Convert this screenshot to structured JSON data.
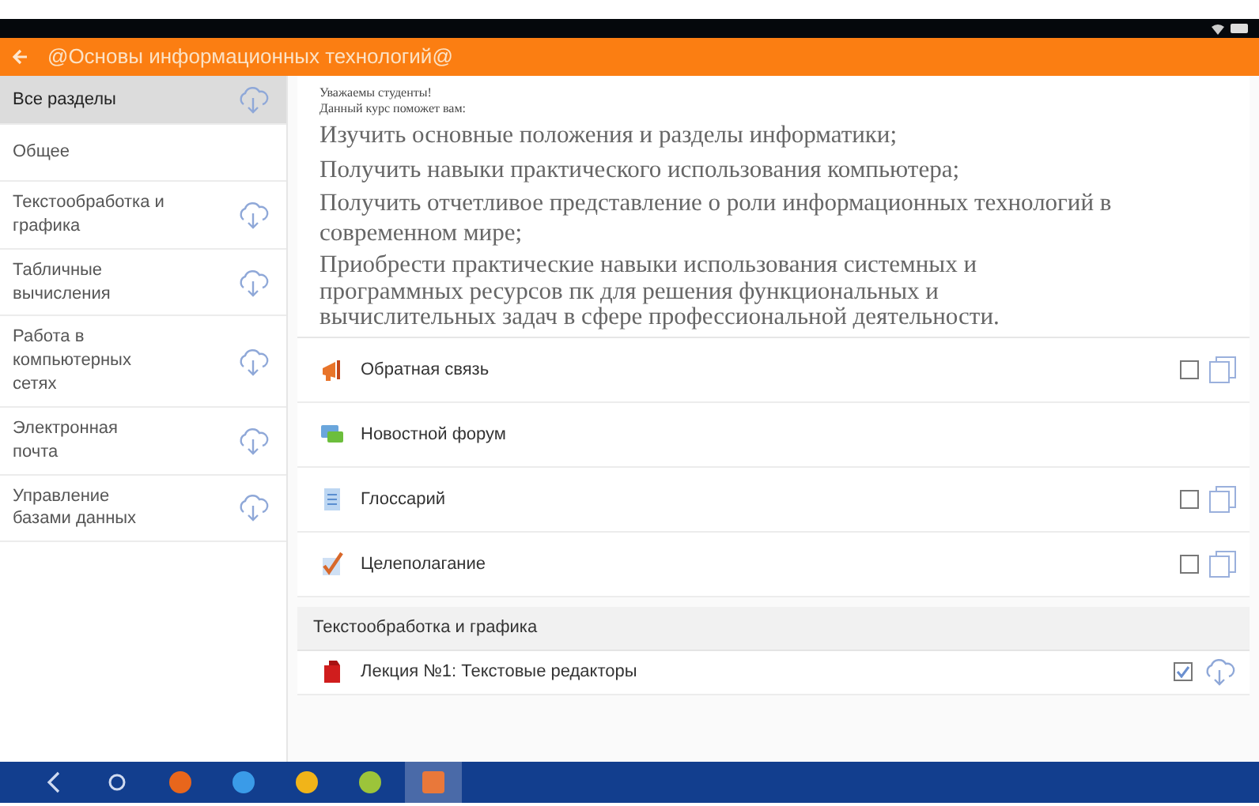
{
  "app_bar": {
    "title": "@Основы информационных технологий@"
  },
  "sidebar": {
    "items": [
      {
        "label": "Все разделы",
        "selected": true,
        "download": true
      },
      {
        "label": "Общее",
        "selected": false,
        "download": false
      },
      {
        "label": "Текстообработка и графика",
        "selected": false,
        "download": true
      },
      {
        "label": "Табличные вычисления",
        "selected": false,
        "download": true
      },
      {
        "label": "Работа в компьютерных сетях",
        "selected": false,
        "download": true
      },
      {
        "label": "Электронная почта",
        "selected": false,
        "download": true
      },
      {
        "label": "Управление базами данных",
        "selected": false,
        "download": true
      }
    ]
  },
  "intro": {
    "greeting": [
      "Уважаемы студенты!",
      "Данный курс поможет вам:"
    ],
    "goals": [
      "Изучить основные положения и разделы информатики;",
      "Получить навыки практического использования компьютера;",
      "Получить отчетливое представление о роли информационных технологий в современном мире;",
      "Приобрести практические навыки использования системных и программных ресурсов пк для решения функциональных и вычислительных задач в сфере профессиональной деятельности."
    ]
  },
  "activities": [
    {
      "kind": "feedback",
      "label": "Обратная связь",
      "has_completion": true,
      "checked": false
    },
    {
      "kind": "forum",
      "label": "Новостной форум",
      "has_completion": false
    },
    {
      "kind": "glossary",
      "label": "Глоссарий",
      "has_completion": true,
      "checked": false
    },
    {
      "kind": "task",
      "label": "Целеполагание",
      "has_completion": true,
      "checked": false
    }
  ],
  "sections": [
    {
      "title": "Текстообработка и графика",
      "items": [
        {
          "kind": "file",
          "label": "Лекция №1: Текстовые редакторы",
          "has_completion": true,
          "checked": true
        }
      ]
    }
  ],
  "taskbar": {
    "apps": [
      {
        "color": "#e8661c",
        "selected": false
      },
      {
        "color": "#3a9be8",
        "selected": false
      },
      {
        "color": "#f1b419",
        "selected": false
      },
      {
        "color": "#9cc43a",
        "selected": false
      },
      {
        "color": "#e9783a",
        "selected": true
      }
    ]
  }
}
